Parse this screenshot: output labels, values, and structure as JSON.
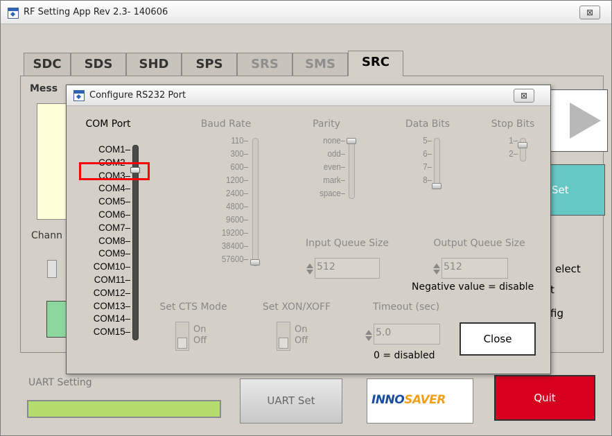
{
  "main_window": {
    "title": "RF Setting App Rev 2.3- 140606",
    "close_glyph": "⊠"
  },
  "tabs": [
    {
      "label": "SDC",
      "state": "normal"
    },
    {
      "label": "SDS",
      "state": "normal"
    },
    {
      "label": "SHD",
      "state": "normal"
    },
    {
      "label": "SPS",
      "state": "normal"
    },
    {
      "label": "SRS",
      "state": "disabled"
    },
    {
      "label": "SMS",
      "state": "disabled"
    },
    {
      "label": "SRC",
      "state": "active"
    }
  ],
  "panel": {
    "message_label": "Mess",
    "channel_label": "Chann",
    "teal_button_label": "Set",
    "select_label": "elect",
    "select_label_2": "t",
    "config_label": "fig"
  },
  "bottom": {
    "uart_label": "UART Setting",
    "uart_set_button": "UART Set",
    "logo_part1": "INNO",
    "logo_part2": "SAVER",
    "quit_button": "Quit"
  },
  "dialog": {
    "title": "Configure RS232 Port",
    "close_glyph": "⊠",
    "com_port": {
      "header": "COM Port",
      "options": [
        "COM1",
        "COM2",
        "COM3",
        "COM4",
        "COM5",
        "COM6",
        "COM7",
        "COM8",
        "COM9",
        "COM10",
        "COM11",
        "COM12",
        "COM13",
        "COM14",
        "COM15"
      ],
      "selected": "COM3"
    },
    "baud_rate": {
      "header": "Baud Rate",
      "options": [
        "110",
        "300",
        "600",
        "1200",
        "2400",
        "4800",
        "9600",
        "19200",
        "38400",
        "57600"
      ],
      "selected": "57600"
    },
    "parity": {
      "header": "Parity",
      "options": [
        "none",
        "odd",
        "even",
        "mark",
        "space"
      ],
      "selected": "none"
    },
    "data_bits": {
      "header": "Data Bits",
      "options": [
        "5",
        "6",
        "7",
        "8"
      ],
      "selected": "8"
    },
    "stop_bits": {
      "header": "Stop Bits",
      "options": [
        "1",
        "2"
      ],
      "selected": "1"
    },
    "input_queue": {
      "label": "Input Queue Size",
      "value": "512"
    },
    "output_queue": {
      "label": "Output Queue Size",
      "value": "512",
      "note": "Negative value = disable"
    },
    "cts_mode": {
      "label": "Set CTS Mode",
      "on": "On",
      "off": "Off"
    },
    "xon_xoff": {
      "label": "Set XON/XOFF",
      "on": "On",
      "off": "Off"
    },
    "timeout": {
      "label": "Timeout (sec)",
      "value": "5.0",
      "note": "0 = disabled"
    },
    "close_button": "Close"
  }
}
